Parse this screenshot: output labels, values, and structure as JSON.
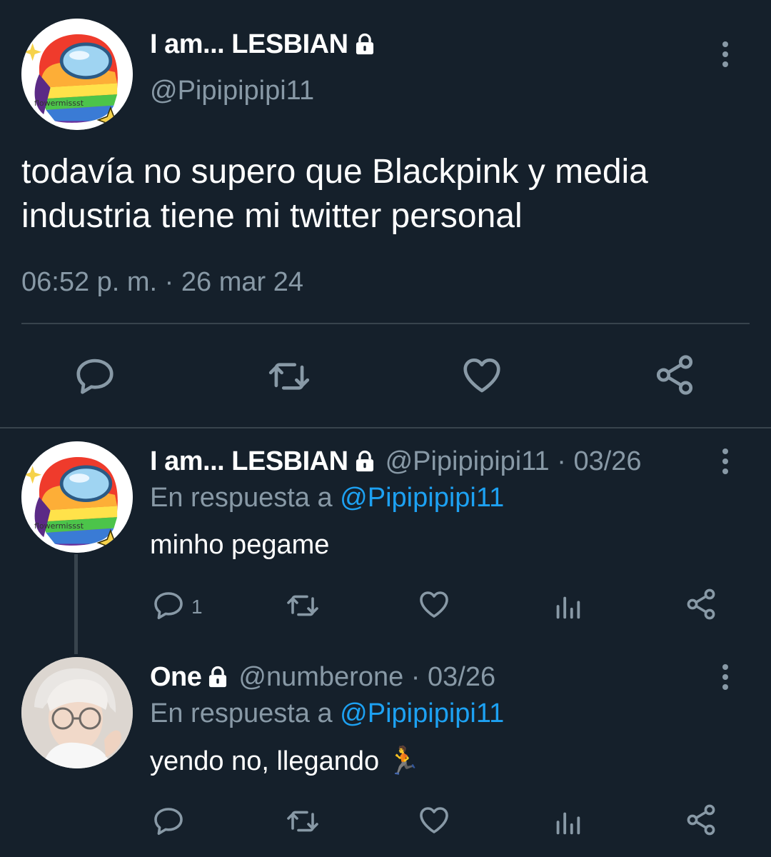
{
  "main_tweet": {
    "display_name": "I am... LESBIAN",
    "handle": "@Pipipipipi11",
    "avatar_watermark": "flowermissst",
    "text_line1": "todavía no supero que Blackpink y media",
    "text_line2": "industria tiene mi twitter personal",
    "timestamp": "06:52 p. m. · 26 mar 24"
  },
  "replies": [
    {
      "display_name": "I am... LESBIAN",
      "handle_date": "@Pipipipipi11 · 03/26",
      "reply_prefix": "En respuesta a",
      "reply_to": "@Pipipipipi11",
      "text": "minho pegame",
      "reply_count": "1",
      "avatar_watermark": "flowermissst"
    },
    {
      "display_name": "One",
      "handle_date": "@numberone · 03/26",
      "reply_prefix": "En respuesta a",
      "reply_to": "@Pipipipipi11",
      "text": "yendo no, llegando 🏃"
    }
  ],
  "colors": {
    "background": "#15202b",
    "muted": "#8899a6",
    "link": "#1da1f2",
    "divider": "#38444d"
  },
  "icons": [
    "lock-icon",
    "more-options-icon",
    "reply-icon",
    "retweet-icon",
    "like-icon",
    "share-icon",
    "analytics-icon"
  ]
}
